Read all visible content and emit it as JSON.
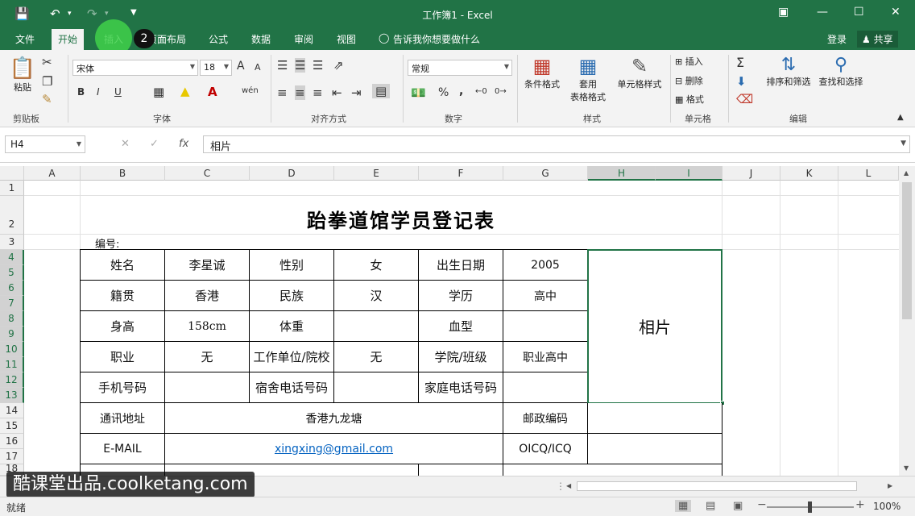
{
  "window": {
    "title": "工作簿1 - Excel"
  },
  "tabs": [
    "文件",
    "开始",
    "插入",
    "页面布局",
    "公式",
    "数据",
    "审阅",
    "视图"
  ],
  "tell_me": "告诉我你想要做什么",
  "account": {
    "login": "登录",
    "share": "共享"
  },
  "annotation": {
    "step": "2"
  },
  "ribbon": {
    "clipboard": {
      "label": "剪贴板",
      "paste": "粘贴"
    },
    "font": {
      "label": "字体",
      "name": "宋体",
      "size": "18",
      "bold": "B",
      "italic": "I",
      "underline": "U",
      "grow": "A",
      "shrink": "A",
      "phonetic": "wén"
    },
    "alignment": {
      "label": "对齐方式"
    },
    "number": {
      "label": "数字",
      "format": "常规",
      "percent": "%",
      "comma": ","
    },
    "styles": {
      "label": "样式",
      "conditional": "条件格式",
      "table_1": "套用",
      "table_2": "表格格式",
      "cell_style": "单元格样式"
    },
    "cells": {
      "label": "单元格",
      "insert": "插入",
      "delete": "删除",
      "format": "格式"
    },
    "editing": {
      "label": "编辑",
      "sort": "排序和筛选",
      "find": "查找和选择"
    }
  },
  "formula_bar": {
    "name_box": "H4",
    "fx": "fx",
    "content": "相片"
  },
  "columns": [
    "A",
    "B",
    "C",
    "D",
    "E",
    "F",
    "G",
    "H",
    "I",
    "J",
    "K",
    "L"
  ],
  "selected_columns": [
    "H",
    "I"
  ],
  "rows": [
    "1",
    "2",
    "3",
    "4",
    "5",
    "6",
    "7",
    "8",
    "9",
    "10",
    "11",
    "12",
    "13",
    "14",
    "15",
    "16",
    "17",
    "18"
  ],
  "selected_rows": [
    "4",
    "5",
    "6",
    "7",
    "8",
    "9",
    "10",
    "11",
    "12",
    "13"
  ],
  "sheet": {
    "title": "跆拳道馆学员登记表",
    "number_label": "编号:",
    "photo": "相片",
    "r1": [
      "姓名",
      "李星诚",
      "性别",
      "女",
      "出生日期",
      "2005"
    ],
    "r2": [
      "籍贯",
      "香港",
      "民族",
      "汉",
      "学历",
      "高中"
    ],
    "r3": [
      "身高",
      "158cm",
      "体重",
      "",
      "血型",
      ""
    ],
    "r4": [
      "职业",
      "无",
      "工作单位/院校",
      "无",
      "学院/班级",
      "职业高中"
    ],
    "r5": [
      "手机号码",
      "",
      "宿舍电话号码",
      "",
      "家庭电话号码",
      ""
    ],
    "r6": {
      "label": "通讯地址",
      "value": "香港九龙塘",
      "label2": "邮政编码",
      "value2": ""
    },
    "r7": {
      "label": "E-MAIL",
      "value": "xingxing@gmail.com",
      "label2": "OICQ/ICQ",
      "value2": ""
    }
  },
  "watermark": "酷课堂出品.coolketang.com",
  "status": {
    "ready": "就绪",
    "zoom": "100%"
  }
}
